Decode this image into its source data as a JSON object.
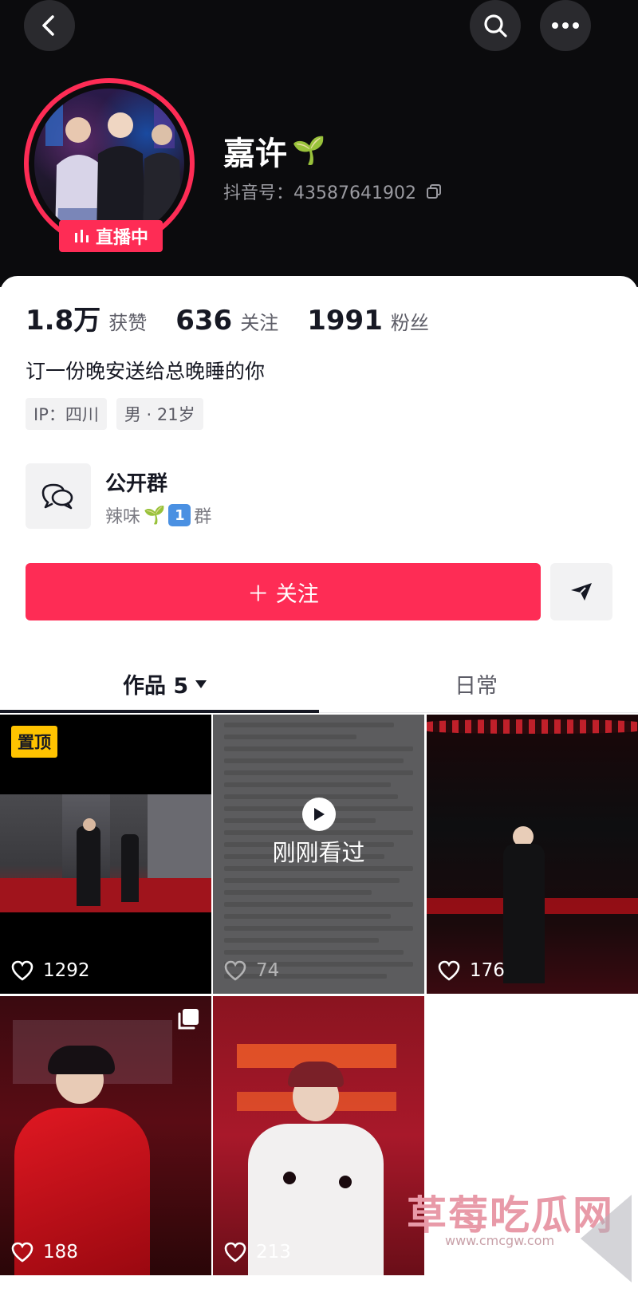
{
  "header": {
    "name": "嘉许",
    "name_emoji": "🌱",
    "douyin_id_label": "抖音号：",
    "douyin_id": "43587641902",
    "live_badge": "直播中",
    "icons": [
      "back-icon",
      "search-icon",
      "more-icon",
      "copy-icon",
      "live-bars-icon"
    ]
  },
  "stats": [
    {
      "value": "1.8万",
      "label": "获赞"
    },
    {
      "value": "636",
      "label": "关注"
    },
    {
      "value": "1991",
      "label": "粉丝"
    }
  ],
  "bio": "订一份晚安送给总晚睡的你",
  "tags": [
    "IP：四川",
    "男 · 21岁"
  ],
  "group": {
    "title": "公开群",
    "sub_prefix": "辣味",
    "sub_emoji": "🌱",
    "sub_number": "1",
    "sub_suffix": "群"
  },
  "actions": {
    "follow_label": "＋ 关注"
  },
  "tabs": [
    {
      "label": "作品 5",
      "active": true
    },
    {
      "label": "日常",
      "active": false
    }
  ],
  "videos": [
    {
      "likes": "1292",
      "pinned_label": "置顶"
    },
    {
      "likes": "74",
      "overlay": "刚刚看过"
    },
    {
      "likes": "176"
    },
    {
      "likes": "188"
    },
    {
      "likes": "213"
    }
  ],
  "watermark": {
    "text": "草莓吃瓜网",
    "url": "www.cmcgw.com"
  },
  "colors": {
    "accent": "#fe2c55",
    "header_bg": "#0b0b0d",
    "pinned": "#ffc300"
  }
}
